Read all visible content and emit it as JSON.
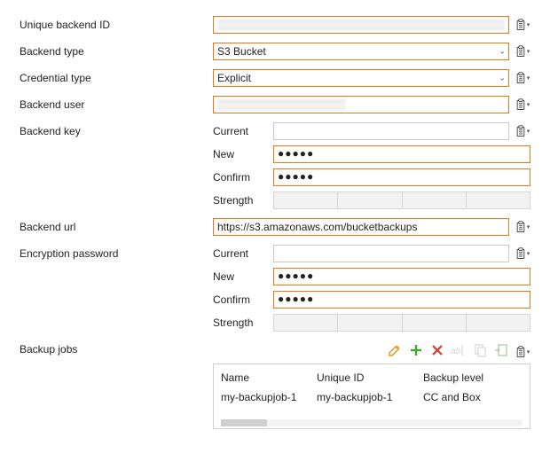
{
  "labels": {
    "unique_backend_id": "Unique backend ID",
    "backend_type": "Backend type",
    "credential_type": "Credential type",
    "backend_user": "Backend user",
    "backend_key": "Backend key",
    "backend_url": "Backend url",
    "encryption_password": "Encryption password",
    "backup_jobs": "Backup jobs"
  },
  "sub": {
    "current": "Current",
    "new": "New",
    "confirm": "Confirm",
    "strength": "Strength"
  },
  "fields": {
    "backend_type_value": "S3 Bucket",
    "credential_type_value": "Explicit",
    "backend_url_value": "https://s3.amazonaws.com/bucketbackups",
    "key_new_mask": "●●●●●",
    "key_confirm_mask": "●●●●●",
    "enc_new_mask": "●●●●●",
    "enc_confirm_mask": "●●●●●"
  },
  "jobs": {
    "headers": {
      "name": "Name",
      "unique_id": "Unique ID",
      "backup_level": "Backup level"
    },
    "rows": [
      {
        "name": "my-backupjob-1",
        "unique_id": "my-backupjob-1",
        "backup_level": "CC and Box"
      }
    ]
  }
}
